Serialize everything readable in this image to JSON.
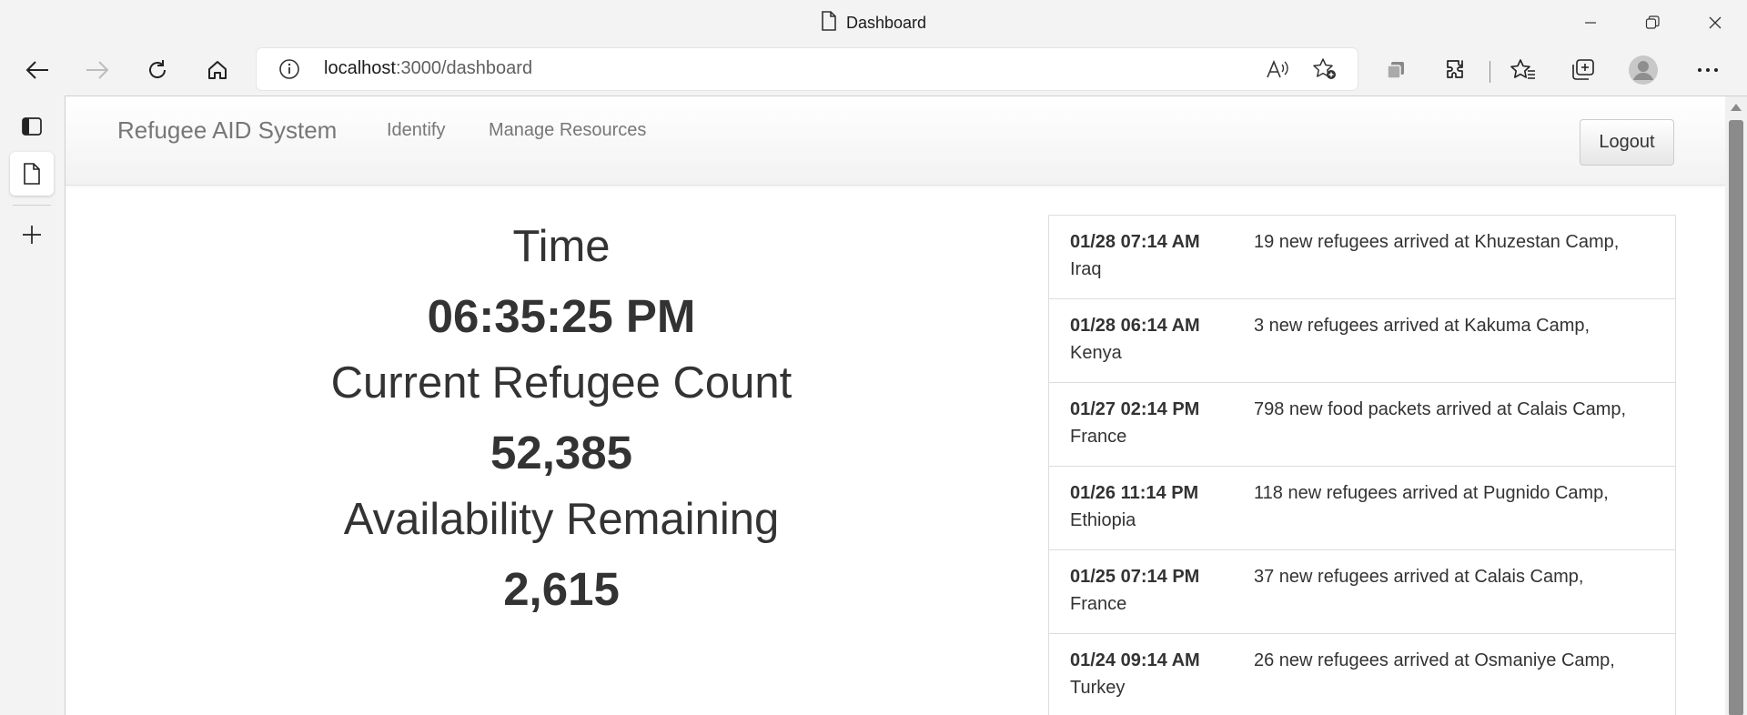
{
  "browser": {
    "tab_title": "Dashboard",
    "url_host": "localhost",
    "url_path": ":3000/dashboard"
  },
  "navbar": {
    "brand": "Refugee AID System",
    "links": [
      "Identify",
      "Manage Resources"
    ],
    "logout_label": "Logout"
  },
  "stats": {
    "time_label": "Time",
    "time_value": "06:35:25 PM",
    "count_label": "Current Refugee Count",
    "count_value": "52,385",
    "availability_label": "Availability Remaining",
    "availability_value": "2,615"
  },
  "feed": [
    {
      "timestamp": "01/28 07:14 AM",
      "line1": "19 new refugees arrived at Khuzestan Camp,",
      "line2": "Iraq"
    },
    {
      "timestamp": "01/28 06:14 AM",
      "line1": "3 new refugees arrived at Kakuma Camp,",
      "line2": "Kenya"
    },
    {
      "timestamp": "01/27 02:14 PM",
      "line1": "798 new food packets arrived at Calais Camp,",
      "line2": "France"
    },
    {
      "timestamp": "01/26 11:14 PM",
      "line1": "118 new refugees arrived at Pugnido Camp,",
      "line2": "Ethiopia"
    },
    {
      "timestamp": "01/25 07:14 PM",
      "line1": "37 new refugees arrived at Calais Camp,",
      "line2": "France"
    },
    {
      "timestamp": "01/24 09:14 AM",
      "line1": "26 new refugees arrived at Osmaniye Camp,",
      "line2": "Turkey"
    }
  ]
}
